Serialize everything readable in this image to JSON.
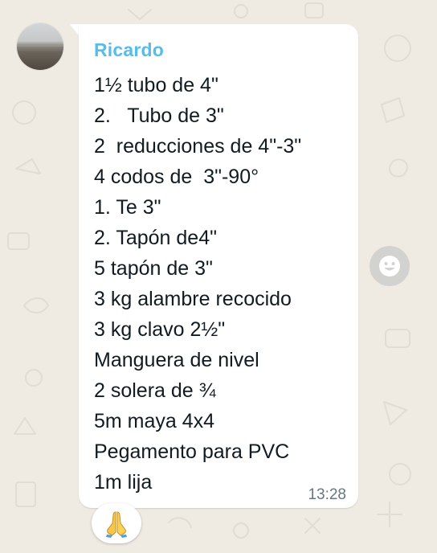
{
  "message": {
    "sender": "Ricardo",
    "lines": [
      "1½ tubo de 4\"",
      "2.   Tubo de 3\"",
      "2  reducciones de 4\"-3\"",
      "4 codos de  3\"-90°",
      "1. Te 3\"",
      "2. Tapón de4\"",
      "5 tapón de 3\"",
      "3 kg alambre recocido",
      "3 kg clavo 2½\"",
      "Manguera de nivel",
      "2 solera de ¾",
      "5m maya 4x4",
      "Pegamento para PVC",
      "1m lija"
    ],
    "time": "13:28",
    "reaction": "folded-hands-emoji"
  },
  "colors": {
    "background": "#efeae2",
    "bubble": "#ffffff",
    "sender": "#53bdeb",
    "text": "#111b21",
    "time": "#667781"
  },
  "icons": {
    "reaction": "folded-hands-icon",
    "emoji_button": "smiley-icon"
  }
}
